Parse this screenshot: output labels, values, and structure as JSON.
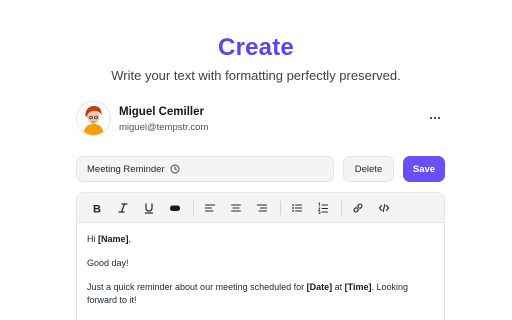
{
  "header": {
    "title": "Create",
    "subtitle": "Write your text with formatting perfectly preserved."
  },
  "user": {
    "name": "Miguel Cemiller",
    "email": "miguel@tempstr.com",
    "avatar_icon": "avatar-illustration"
  },
  "actions": {
    "title_value": "Meeting Reminder",
    "delete_label": "Delete",
    "save_label": "Save",
    "more_icon": "more-horizontal-icon"
  },
  "toolbar": {
    "buttons": [
      "bold",
      "italic",
      "underline",
      "highlight",
      "align-left",
      "align-center",
      "align-right",
      "bullet-list",
      "numbered-list",
      "link",
      "code"
    ]
  },
  "content": {
    "line1_pre": "Hi ",
    "line1_var": "[Name]",
    "line1_post": ",",
    "line2": "Good day!",
    "line3_pre": "Just a quick reminder about our meeting scheduled for ",
    "line3_var1": "[Date]",
    "line3_mid": " at ",
    "line3_var2": "[Time]",
    "line3_post": ". Looking forward to it!"
  },
  "colors": {
    "accent": "#5b45f0",
    "save_button": "#6b4ff6"
  }
}
